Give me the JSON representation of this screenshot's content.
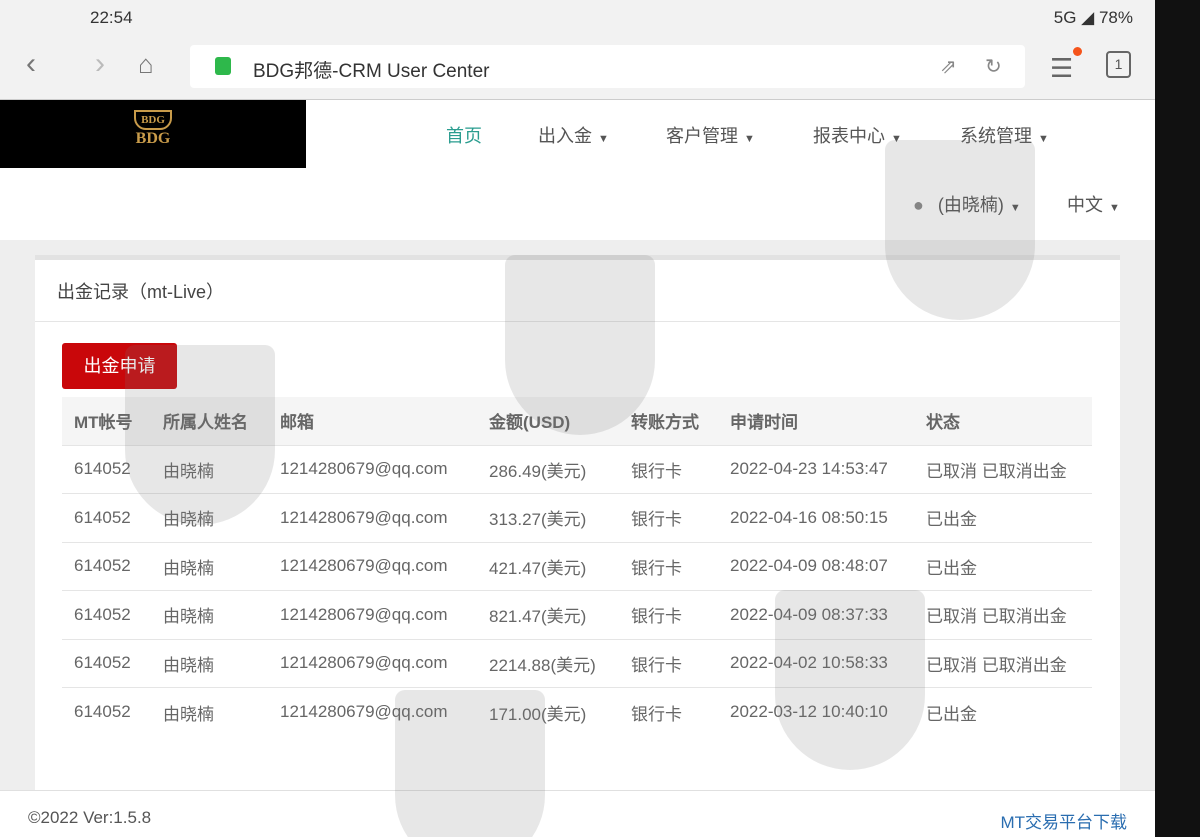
{
  "status_bar": {
    "time": "22:54",
    "indicators": "5G ◢ 78%"
  },
  "browser": {
    "url_title": "BDG邦德-CRM User Center",
    "tab_count": "1"
  },
  "logo": {
    "text": "BDG"
  },
  "nav": [
    {
      "label": "首页"
    },
    {
      "label": "出入金"
    },
    {
      "label": "客户管理"
    },
    {
      "label": "报表中心"
    },
    {
      "label": "系统管理"
    }
  ],
  "user": {
    "name": "(由晓楠)",
    "language": "中文"
  },
  "card": {
    "title": "出金记录（mt-Live）",
    "apply_button": "出金申请"
  },
  "table": {
    "headers": [
      "MT帐号",
      "所属人姓名",
      "邮箱",
      "金额(USD)",
      "转账方式",
      "申请时间",
      "状态"
    ],
    "rows": [
      [
        "614052",
        "由晓楠",
        "1214280679@qq.com",
        "286.49(美元)",
        "银行卡",
        "2022-04-23 14:53:47",
        "已取消 已取消出金"
      ],
      [
        "614052",
        "由晓楠",
        "1214280679@qq.com",
        "313.27(美元)",
        "银行卡",
        "2022-04-16 08:50:15",
        "已出金"
      ],
      [
        "614052",
        "由晓楠",
        "1214280679@qq.com",
        "421.47(美元)",
        "银行卡",
        "2022-04-09 08:48:07",
        "已出金"
      ],
      [
        "614052",
        "由晓楠",
        "1214280679@qq.com",
        "821.47(美元)",
        "银行卡",
        "2022-04-09 08:37:33",
        "已取消 已取消出金"
      ],
      [
        "614052",
        "由晓楠",
        "1214280679@qq.com",
        "2214.88(美元)",
        "银行卡",
        "2022-04-02 10:58:33",
        "已取消 已取消出金"
      ],
      [
        "614052",
        "由晓楠",
        "1214280679@qq.com",
        "171.00(美元)",
        "银行卡",
        "2022-03-12 10:40:10",
        "已出金"
      ]
    ]
  },
  "footer": {
    "version": "©2022 Ver:1.5.8",
    "download_link": "MT交易平台下载"
  }
}
